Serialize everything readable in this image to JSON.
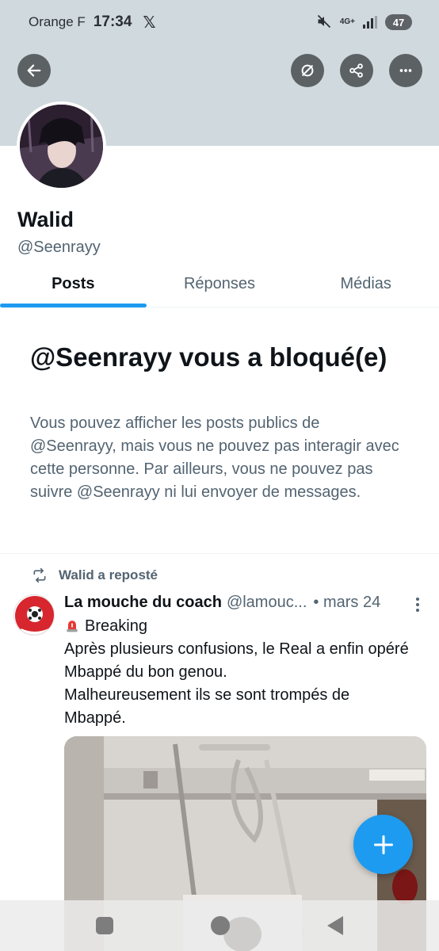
{
  "status_bar": {
    "carrier": "Orange F",
    "time": "17:34",
    "network": "4G+",
    "battery": "47"
  },
  "header": {
    "back_icon": "arrow-left-icon",
    "translate_icon": "no-translate-icon",
    "share_icon": "share-icon",
    "more_icon": "more-horizontal-icon"
  },
  "profile": {
    "name": "Walid",
    "handle": "@Seenrayy"
  },
  "tabs": [
    {
      "label": "Posts",
      "active": true
    },
    {
      "label": "Réponses",
      "active": false
    },
    {
      "label": "Médias",
      "active": false
    }
  ],
  "blocked": {
    "title": "@Seenrayy vous a bloqué(e)",
    "description": "Vous pouvez afficher les posts publics de @Seenrayy, mais vous ne pouvez pas interagir avec cette personne. Par ailleurs, vous ne pouvez pas suivre @Seenrayy ni lui envoyer de messages."
  },
  "post": {
    "repost_label": "Walid a reposté",
    "author": "La mouche du coach",
    "handle": "@lamouc...",
    "date": "• mars 24",
    "line1": "Breaking",
    "line2": "Après plusieurs confusions, le Real a enfin opéré Mbappé du bon genou.",
    "line3": "Malheureusement ils se sont trompés de Mbappé."
  },
  "colors": {
    "accent": "#1d9bf0",
    "banner": "#cfd9de",
    "secondary_text": "#536471"
  }
}
